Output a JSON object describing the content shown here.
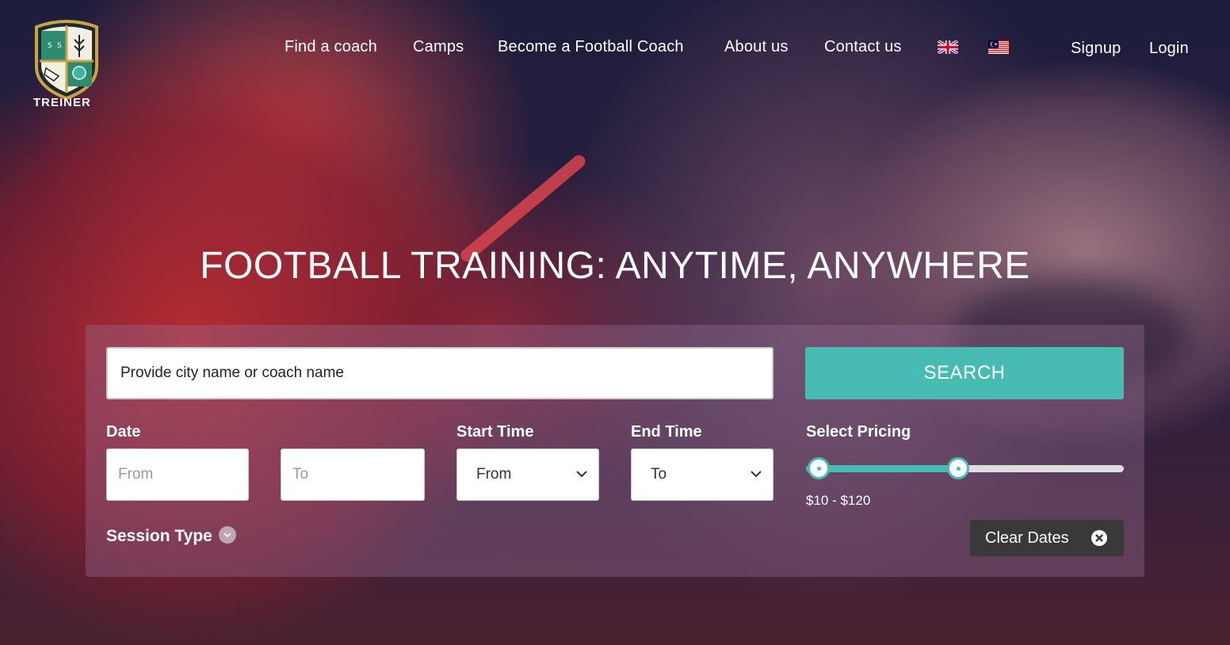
{
  "brand": {
    "name": "TREINER"
  },
  "nav": {
    "items": [
      "Find a coach",
      "Camps",
      "Become a Football Coach",
      "About us",
      "Contact us"
    ],
    "languages": [
      "english-flag-icon",
      "malaysia-flag-icon"
    ],
    "signup": "Signup",
    "login": "Login"
  },
  "hero": {
    "title": "FOOTBALL TRAINING: ANYTIME, ANYWHERE"
  },
  "search": {
    "placeholder": "Provide city name or coach name",
    "button": "SEARCH"
  },
  "filters": {
    "date_label": "Date",
    "date_from_placeholder": "From",
    "date_to_placeholder": "To",
    "start_time_label": "Start Time",
    "start_time_value": "From",
    "end_time_label": "End Time",
    "end_time_value": "To",
    "pricing_label": "Select Pricing",
    "pricing_range": "$10 - $120",
    "pricing_min_fraction": 0.04,
    "pricing_max_fraction": 0.48,
    "session_type_label": "Session Type",
    "clear_dates": "Clear Dates"
  },
  "colors": {
    "accent": "#48bcb2",
    "clear_button": "#3a3838"
  }
}
